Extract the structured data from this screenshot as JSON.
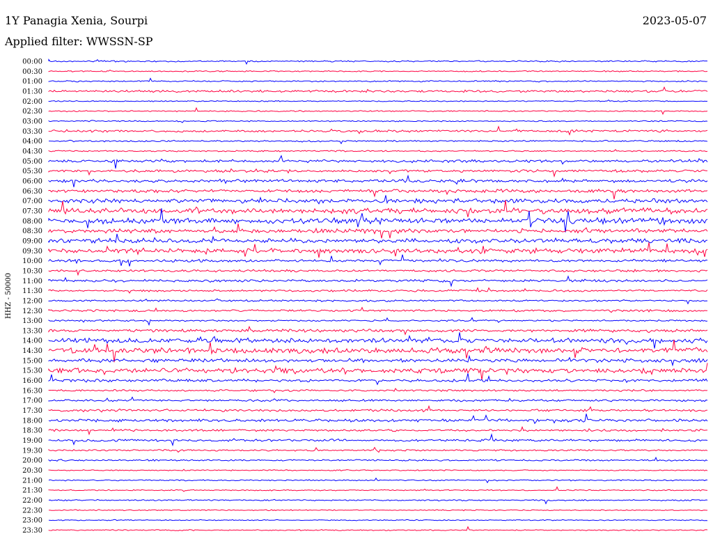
{
  "header": {
    "station": "1Y Panagia Xenia, Sourpi",
    "date": "2023-05-07",
    "filter": "Applied filter: WWSSN-SP"
  },
  "chart_data": {
    "type": "line",
    "title": "1Y Panagia Xenia, Sourpi",
    "ylabel": "HHZ - 50000",
    "colors": [
      "#0000ff",
      "#ff0040"
    ],
    "rows": [
      {
        "time": "00:00",
        "activity": 0.15
      },
      {
        "time": "00:30",
        "activity": 0.12
      },
      {
        "time": "01:00",
        "activity": 0.15
      },
      {
        "time": "01:30",
        "activity": 0.35
      },
      {
        "time": "02:00",
        "activity": 0.1
      },
      {
        "time": "02:30",
        "activity": 0.12
      },
      {
        "time": "03:00",
        "activity": 0.12
      },
      {
        "time": "03:30",
        "activity": 0.35
      },
      {
        "time": "04:00",
        "activity": 0.2
      },
      {
        "time": "04:30",
        "activity": 0.15
      },
      {
        "time": "05:00",
        "activity": 0.45
      },
      {
        "time": "05:30",
        "activity": 0.4
      },
      {
        "time": "06:00",
        "activity": 0.5
      },
      {
        "time": "06:30",
        "activity": 0.55
      },
      {
        "time": "07:00",
        "activity": 0.75
      },
      {
        "time": "07:30",
        "activity": 0.95
      },
      {
        "time": "08:00",
        "activity": 1.0
      },
      {
        "time": "08:30",
        "activity": 0.7
      },
      {
        "time": "09:00",
        "activity": 0.75
      },
      {
        "time": "09:30",
        "activity": 0.8
      },
      {
        "time": "10:00",
        "activity": 0.4
      },
      {
        "time": "10:30",
        "activity": 0.35
      },
      {
        "time": "11:00",
        "activity": 0.4
      },
      {
        "time": "11:30",
        "activity": 0.3
      },
      {
        "time": "12:00",
        "activity": 0.25
      },
      {
        "time": "12:30",
        "activity": 0.3
      },
      {
        "time": "13:00",
        "activity": 0.2
      },
      {
        "time": "13:30",
        "activity": 0.45
      },
      {
        "time": "14:00",
        "activity": 0.8
      },
      {
        "time": "14:30",
        "activity": 1.0
      },
      {
        "time": "15:00",
        "activity": 0.6
      },
      {
        "time": "15:30",
        "activity": 0.85
      },
      {
        "time": "16:00",
        "activity": 0.45
      },
      {
        "time": "16:30",
        "activity": 0.25
      },
      {
        "time": "17:00",
        "activity": 0.3
      },
      {
        "time": "17:30",
        "activity": 0.35
      },
      {
        "time": "18:00",
        "activity": 0.45
      },
      {
        "time": "18:30",
        "activity": 0.3
      },
      {
        "time": "19:00",
        "activity": 0.35
      },
      {
        "time": "19:30",
        "activity": 0.2
      },
      {
        "time": "20:00",
        "activity": 0.2
      },
      {
        "time": "20:30",
        "activity": 0.1
      },
      {
        "time": "21:00",
        "activity": 0.12
      },
      {
        "time": "21:30",
        "activity": 0.12
      },
      {
        "time": "22:00",
        "activity": 0.15
      },
      {
        "time": "22:30",
        "activity": 0.1
      },
      {
        "time": "23:00",
        "activity": 0.08
      },
      {
        "time": "23:30",
        "activity": 0.1
      }
    ]
  }
}
